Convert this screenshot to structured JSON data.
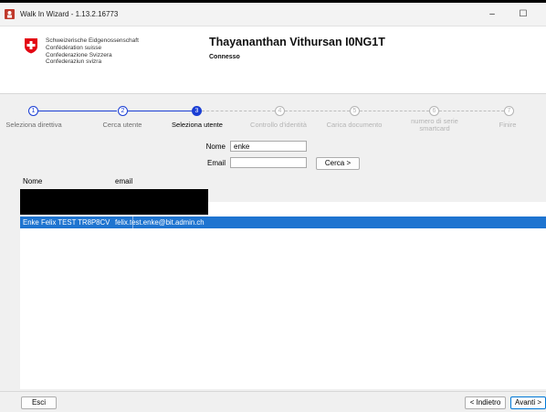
{
  "window": {
    "title": "Walk In Wizard - 1.13.2.16773",
    "min_symbol": "–",
    "max_symbol": "☐",
    "close_symbol": "✕"
  },
  "header": {
    "confederation_lines": [
      "Schweizerische Eidgenossenschaft",
      "Confédération suisse",
      "Confederazione Svizzera",
      "Confederaziun svizra"
    ],
    "user_name": "Thayananthan Vithursan I0NG1T",
    "connection_status": "Connesso"
  },
  "steps": [
    {
      "number": "1",
      "label": "Seleziona direttiva",
      "state": "done"
    },
    {
      "number": "2",
      "label": "Cerca utente",
      "state": "done"
    },
    {
      "number": "3",
      "label": "Seleziona utente",
      "state": "current"
    },
    {
      "number": "4",
      "label": "Controllo d'identità",
      "state": "todo"
    },
    {
      "number": "5",
      "label": "Carica documento",
      "state": "todo"
    },
    {
      "number": "6",
      "label": "numero di serie smartcard",
      "state": "todo"
    },
    {
      "number": "7",
      "label": "Finire",
      "state": "todo"
    }
  ],
  "search": {
    "name_label": "Nome",
    "name_value": "enke",
    "email_label": "Email",
    "email_value": "",
    "search_button": "Cerca >"
  },
  "results": {
    "columns": [
      "Nome",
      "email"
    ],
    "rows": [
      {
        "name": "Enke Felix TEST TR8P8CV",
        "email": "felix.test.enke@bit.admin.ch"
      }
    ]
  },
  "footer": {
    "exit_button": "Esci",
    "back_button": "< Indietro",
    "next_button": "Avanti >"
  },
  "colors": {
    "accent": "#1a3ed4",
    "selection": "#1e74d0",
    "swiss_red": "#e30613"
  }
}
